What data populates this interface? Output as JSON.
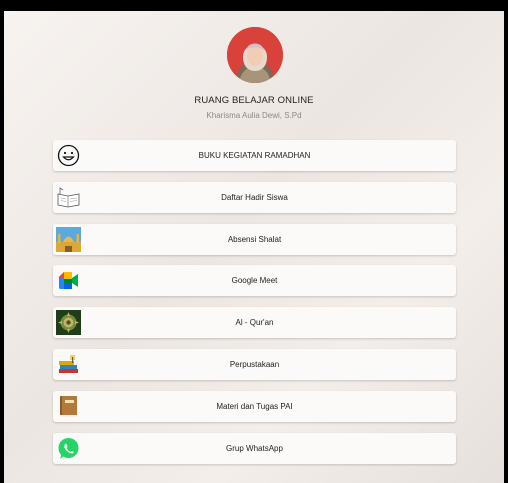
{
  "profile": {
    "name": "RUANG BELAJAR ONLINE",
    "subtitle": "Kharisma Aulia Dewi, S.Pd",
    "avatar_bg": "#d8423a"
  },
  "links": [
    {
      "label": "BUKU KEGIATAN RAMADHAN",
      "icon": "smiley-icon"
    },
    {
      "label": "Daftar Hadir Siswa",
      "icon": "open-book-icon"
    },
    {
      "label": "Absensi Shalat",
      "icon": "mosque-icon"
    },
    {
      "label": "Google Meet",
      "icon": "google-meet-icon"
    },
    {
      "label": "Al - Qur'an",
      "icon": "ornament-icon"
    },
    {
      "label": "Perpustakaan",
      "icon": "books-icon"
    },
    {
      "label": "Materi dan Tugas PAI",
      "icon": "book-icon"
    },
    {
      "label": "Grup WhatsApp",
      "icon": "whatsapp-icon"
    }
  ]
}
